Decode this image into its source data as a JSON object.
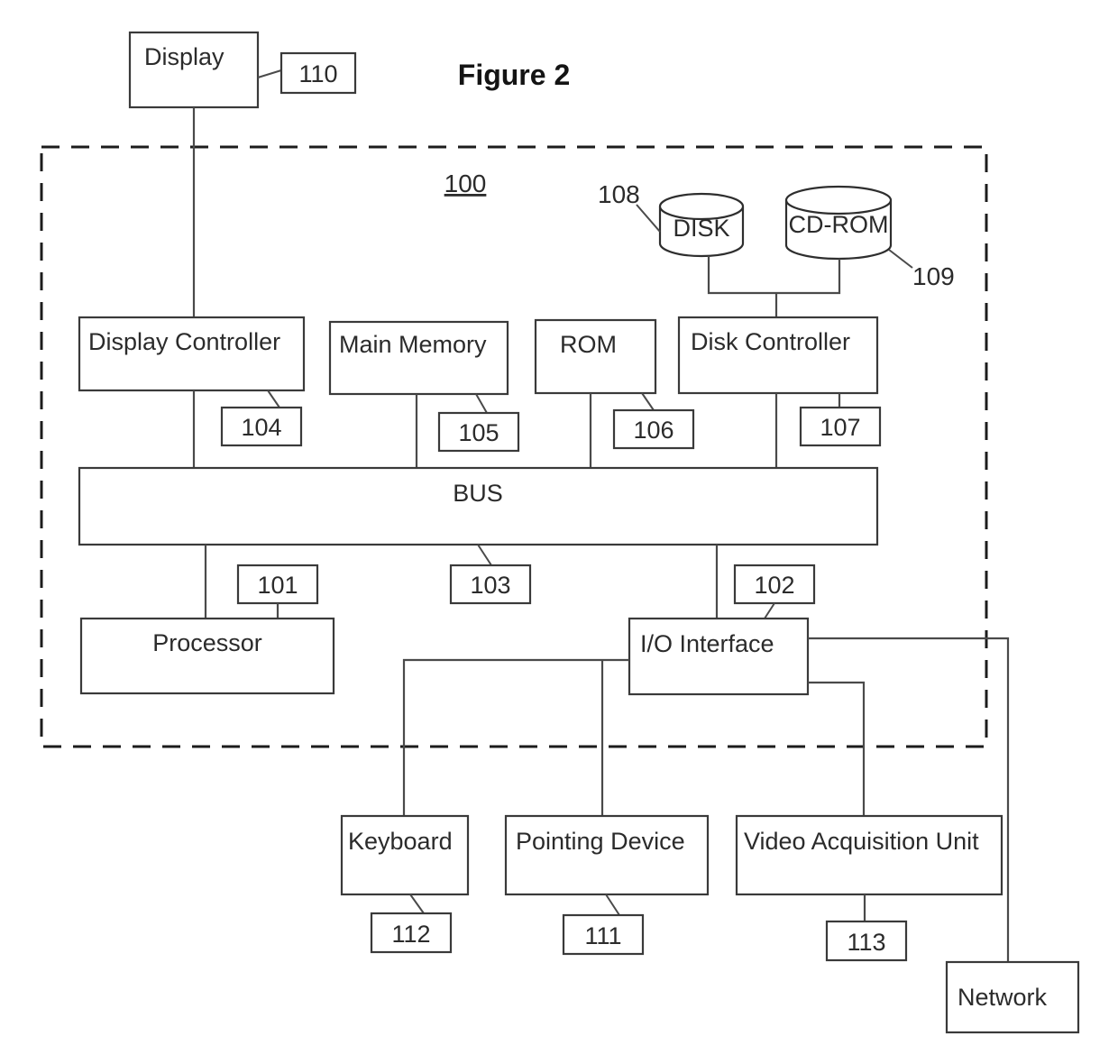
{
  "figure": {
    "title": "Figure 2",
    "system_reference": "100"
  },
  "boxes": {
    "display": {
      "label": "Display",
      "ref": "110"
    },
    "display_controller": {
      "label": "Display Controller",
      "ref": "104"
    },
    "main_memory": {
      "label": "Main Memory",
      "ref": "105"
    },
    "rom": {
      "label": "ROM",
      "ref": "106"
    },
    "disk_controller": {
      "label": "Disk Controller",
      "ref": "107"
    },
    "bus": {
      "label": "BUS",
      "ref": "103"
    },
    "processor": {
      "label": "Processor",
      "ref": "101"
    },
    "io_interface": {
      "label": "I/O Interface",
      "ref": "102"
    },
    "keyboard": {
      "label": "Keyboard",
      "ref": "112"
    },
    "pointing_device": {
      "label": "Pointing Device",
      "ref": "111"
    },
    "video_acquisition_unit": {
      "label": "Video Acquisition Unit",
      "ref": "113"
    },
    "network": {
      "label": "Network"
    }
  },
  "storage": {
    "disk": {
      "label": "DISK",
      "ref": "108"
    },
    "cdrom": {
      "label": "CD-ROM",
      "ref": "109"
    }
  },
  "colors": {
    "line": "#3a3a3a",
    "text": "#2b2b2b",
    "background": "#ffffff"
  }
}
